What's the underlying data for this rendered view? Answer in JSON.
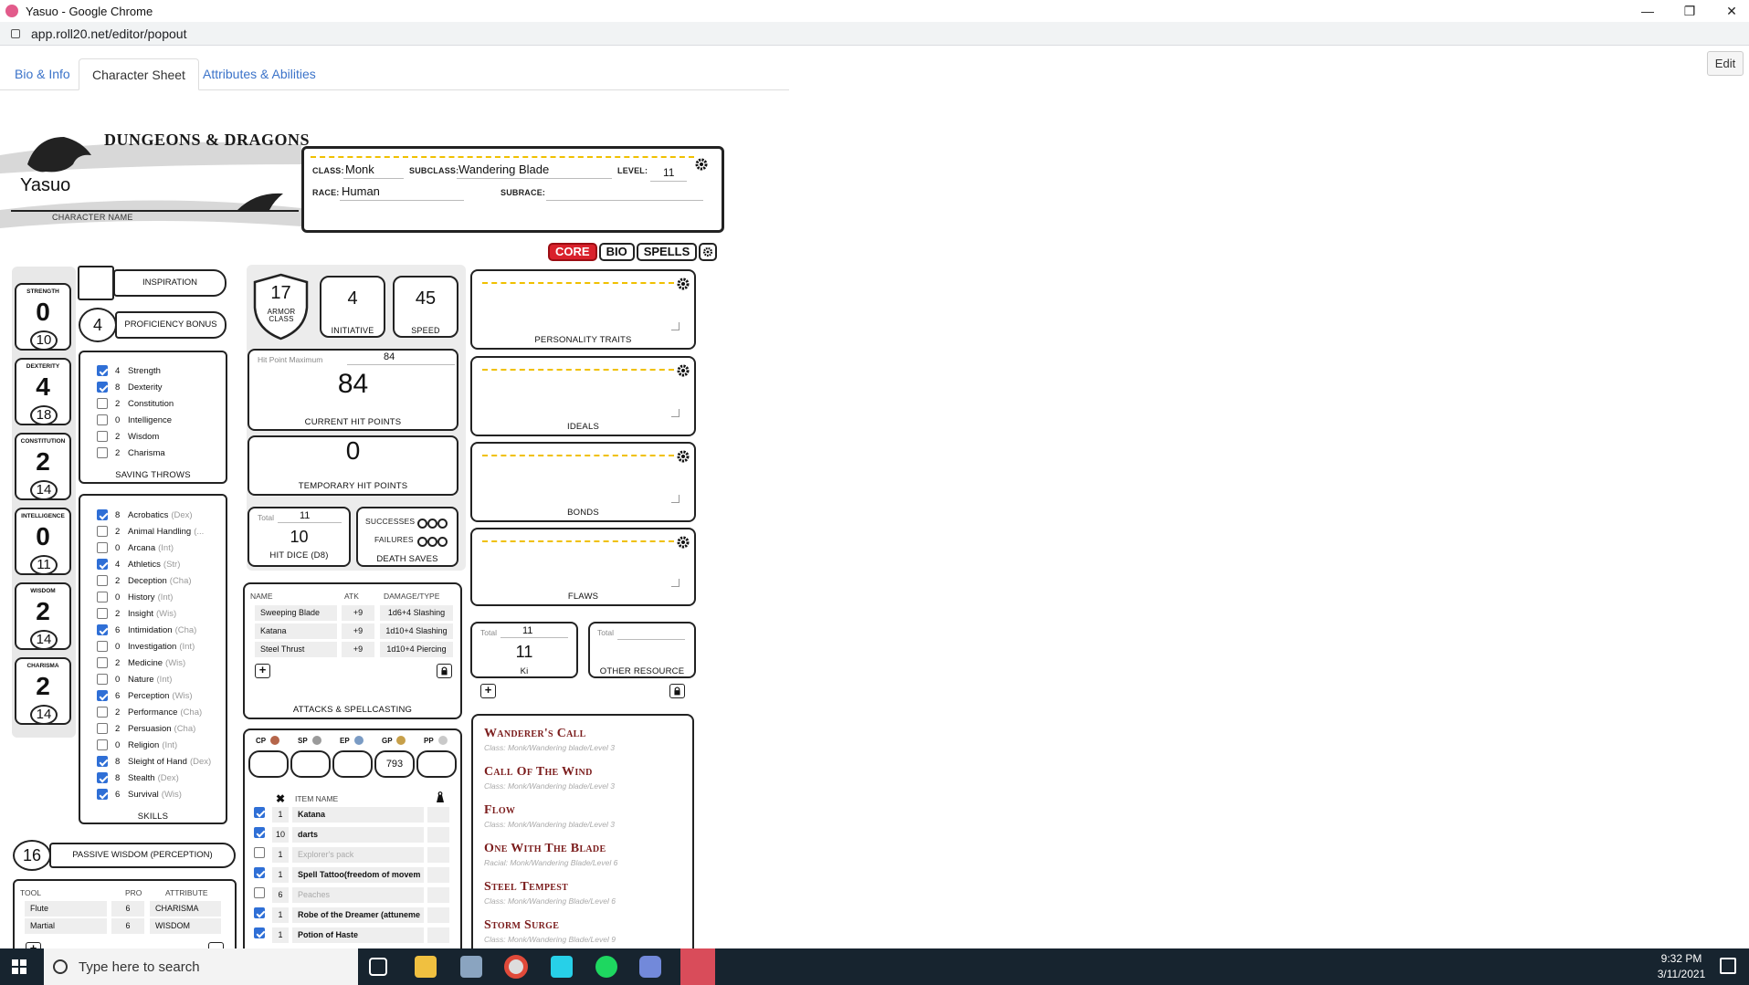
{
  "window": {
    "title": "Yasuo - Google Chrome",
    "url": "app.roll20.net/editor/popout"
  },
  "tabs": [
    "Bio & Info",
    "Character Sheet",
    "Attributes & Abilities"
  ],
  "edit_label": "Edit",
  "header": {
    "logo": "DUNGEONS & DRAGONS",
    "character_name": "Yasuo",
    "character_name_label": "CHARACTER NAME",
    "class_label": "CLASS:",
    "class": "Monk",
    "subclass_label": "SUBCLASS:",
    "subclass": "Wandering Blade",
    "level_label": "LEVEL:",
    "level": "11",
    "race_label": "RACE:",
    "race": "Human",
    "subrace_label": "SUBRACE:",
    "subrace": ""
  },
  "sheet_tabs": [
    "CORE",
    "BIO",
    "SPELLS"
  ],
  "abilities": [
    {
      "name": "STRENGTH",
      "mod": "0",
      "score": "10"
    },
    {
      "name": "DEXTERITY",
      "mod": "4",
      "score": "18"
    },
    {
      "name": "CONSTITUTION",
      "mod": "2",
      "score": "14"
    },
    {
      "name": "INTELLIGENCE",
      "mod": "0",
      "score": "11"
    },
    {
      "name": "WISDOM",
      "mod": "2",
      "score": "14"
    },
    {
      "name": "CHARISMA",
      "mod": "2",
      "score": "14"
    }
  ],
  "inspiration_label": "INSPIRATION",
  "proficiency": {
    "value": "4",
    "label": "PROFICIENCY BONUS"
  },
  "saving_throws": {
    "label": "SAVING THROWS",
    "items": [
      {
        "checked": true,
        "value": "4",
        "name": "Strength"
      },
      {
        "checked": true,
        "value": "8",
        "name": "Dexterity"
      },
      {
        "checked": false,
        "value": "2",
        "name": "Constitution"
      },
      {
        "checked": false,
        "value": "0",
        "name": "Intelligence"
      },
      {
        "checked": false,
        "value": "2",
        "name": "Wisdom"
      },
      {
        "checked": false,
        "value": "2",
        "name": "Charisma"
      }
    ]
  },
  "skills": {
    "label": "SKILLS",
    "items": [
      {
        "checked": true,
        "value": "8",
        "name": "Acrobatics",
        "attr": "(Dex)"
      },
      {
        "checked": false,
        "value": "2",
        "name": "Animal Handling",
        "attr": "(..."
      },
      {
        "checked": false,
        "value": "0",
        "name": "Arcana",
        "attr": "(Int)"
      },
      {
        "checked": true,
        "value": "4",
        "name": "Athletics",
        "attr": "(Str)"
      },
      {
        "checked": false,
        "value": "2",
        "name": "Deception",
        "attr": "(Cha)"
      },
      {
        "checked": false,
        "value": "0",
        "name": "History",
        "attr": "(Int)"
      },
      {
        "checked": false,
        "value": "2",
        "name": "Insight",
        "attr": "(Wis)"
      },
      {
        "checked": true,
        "value": "6",
        "name": "Intimidation",
        "attr": "(Cha)"
      },
      {
        "checked": false,
        "value": "0",
        "name": "Investigation",
        "attr": "(Int)"
      },
      {
        "checked": false,
        "value": "2",
        "name": "Medicine",
        "attr": "(Wis)"
      },
      {
        "checked": false,
        "value": "0",
        "name": "Nature",
        "attr": "(Int)"
      },
      {
        "checked": true,
        "value": "6",
        "name": "Perception",
        "attr": "(Wis)"
      },
      {
        "checked": false,
        "value": "2",
        "name": "Performance",
        "attr": "(Cha)"
      },
      {
        "checked": false,
        "value": "2",
        "name": "Persuasion",
        "attr": "(Cha)"
      },
      {
        "checked": false,
        "value": "0",
        "name": "Religion",
        "attr": "(Int)"
      },
      {
        "checked": true,
        "value": "8",
        "name": "Sleight of Hand",
        "attr": "(Dex)"
      },
      {
        "checked": true,
        "value": "8",
        "name": "Stealth",
        "attr": "(Dex)"
      },
      {
        "checked": true,
        "value": "6",
        "name": "Survival",
        "attr": "(Wis)"
      }
    ]
  },
  "passive_wisdom": {
    "value": "16",
    "label": "PASSIVE WISDOM (PERCEPTION)"
  },
  "tools": {
    "headers": [
      "TOOL",
      "PRO",
      "ATTRIBUTE"
    ],
    "rows": [
      {
        "tool": "Flute",
        "pro": "6",
        "attribute": "CHARISMA"
      },
      {
        "tool": "Martial",
        "pro": "6",
        "attribute": "WISDOM"
      }
    ]
  },
  "combat": {
    "armor_class": "17",
    "armor_class_label": "ARMOR CLASS",
    "initiative": "4",
    "initiative_label": "INITIATIVE",
    "speed": "45",
    "speed_label": "SPEED",
    "hp_max_label": "Hit Point Maximum",
    "hp_max": "84",
    "hp_current": "84",
    "hp_current_label": "CURRENT HIT POINTS",
    "hp_temp": "0",
    "hp_temp_label": "TEMPORARY HIT POINTS",
    "hit_dice_total_label": "Total",
    "hit_dice_total": "11",
    "hit_dice": "10",
    "hit_dice_label": "HIT DICE (D8)",
    "successes_label": "SUCCESSES",
    "failures_label": "FAILURES",
    "death_saves_label": "DEATH SAVES"
  },
  "attacks": {
    "headers": [
      "NAME",
      "ATK",
      "DAMAGE/TYPE"
    ],
    "rows": [
      {
        "name": "Sweeping Blade",
        "atk": "+9",
        "damage": "1d6+4 Slashing"
      },
      {
        "name": "Katana",
        "atk": "+9",
        "damage": "1d10+4 Slashing"
      },
      {
        "name": "Steel Thrust",
        "atk": "+9",
        "damage": "1d10+4 Piercing"
      }
    ],
    "label": "ATTACKS & SPELLCASTING"
  },
  "coins": [
    {
      "label": "CP",
      "value": "",
      "color": "#b5654a"
    },
    {
      "label": "SP",
      "value": "",
      "color": "#9a9a9a"
    },
    {
      "label": "EP",
      "value": "",
      "color": "#7a9bc4"
    },
    {
      "label": "GP",
      "value": "793",
      "color": "#c7a04a"
    },
    {
      "label": "PP",
      "value": "",
      "color": "#c9c9c9"
    }
  ],
  "equipment": {
    "header": "ITEM NAME",
    "rows": [
      {
        "checked": true,
        "qty": "1",
        "name": "Katana",
        "muted": false
      },
      {
        "checked": true,
        "qty": "10",
        "name": "darts",
        "muted": false
      },
      {
        "checked": false,
        "qty": "1",
        "name": "Explorer's pack",
        "muted": true
      },
      {
        "checked": true,
        "qty": "1",
        "name": "Spell Tattoo(freedom of movem",
        "muted": false
      },
      {
        "checked": false,
        "qty": "6",
        "name": "Peaches",
        "muted": true
      },
      {
        "checked": true,
        "qty": "1",
        "name": "Robe of the Dreamer (attuneme",
        "muted": false
      },
      {
        "checked": true,
        "qty": "1",
        "name": "Potion of Haste",
        "muted": false
      }
    ]
  },
  "traits": [
    "PERSONALITY TRAITS",
    "IDEALS",
    "BONDS",
    "FLAWS"
  ],
  "ki": {
    "total_label": "Total",
    "total": "11",
    "value": "11",
    "label": "Ki"
  },
  "other_resource": {
    "total_label": "Total",
    "label": "OTHER RESOURCE"
  },
  "features": [
    {
      "title": "Wanderer's Call",
      "sub": "Class: Monk/Wandering blade/Level 3"
    },
    {
      "title": "Call Of The Wind",
      "sub": "Class: Monk/Wandering blade/Level 3"
    },
    {
      "title": "Flow",
      "sub": "Class: Monk/Wandering blade/Level 3"
    },
    {
      "title": "One With The Blade",
      "sub": "Racial: Monk/Wandering Blade/Level 6"
    },
    {
      "title": "Steel Tempest",
      "sub": "Class: Monk/Wandering Blade/Level 6"
    },
    {
      "title": "Storm Surge",
      "sub": "Class: Monk/Wandering Blade/Level 9"
    }
  ],
  "taskbar": {
    "search_placeholder": "Type here to search",
    "time": "9:32 PM",
    "date": "3/11/2021"
  }
}
